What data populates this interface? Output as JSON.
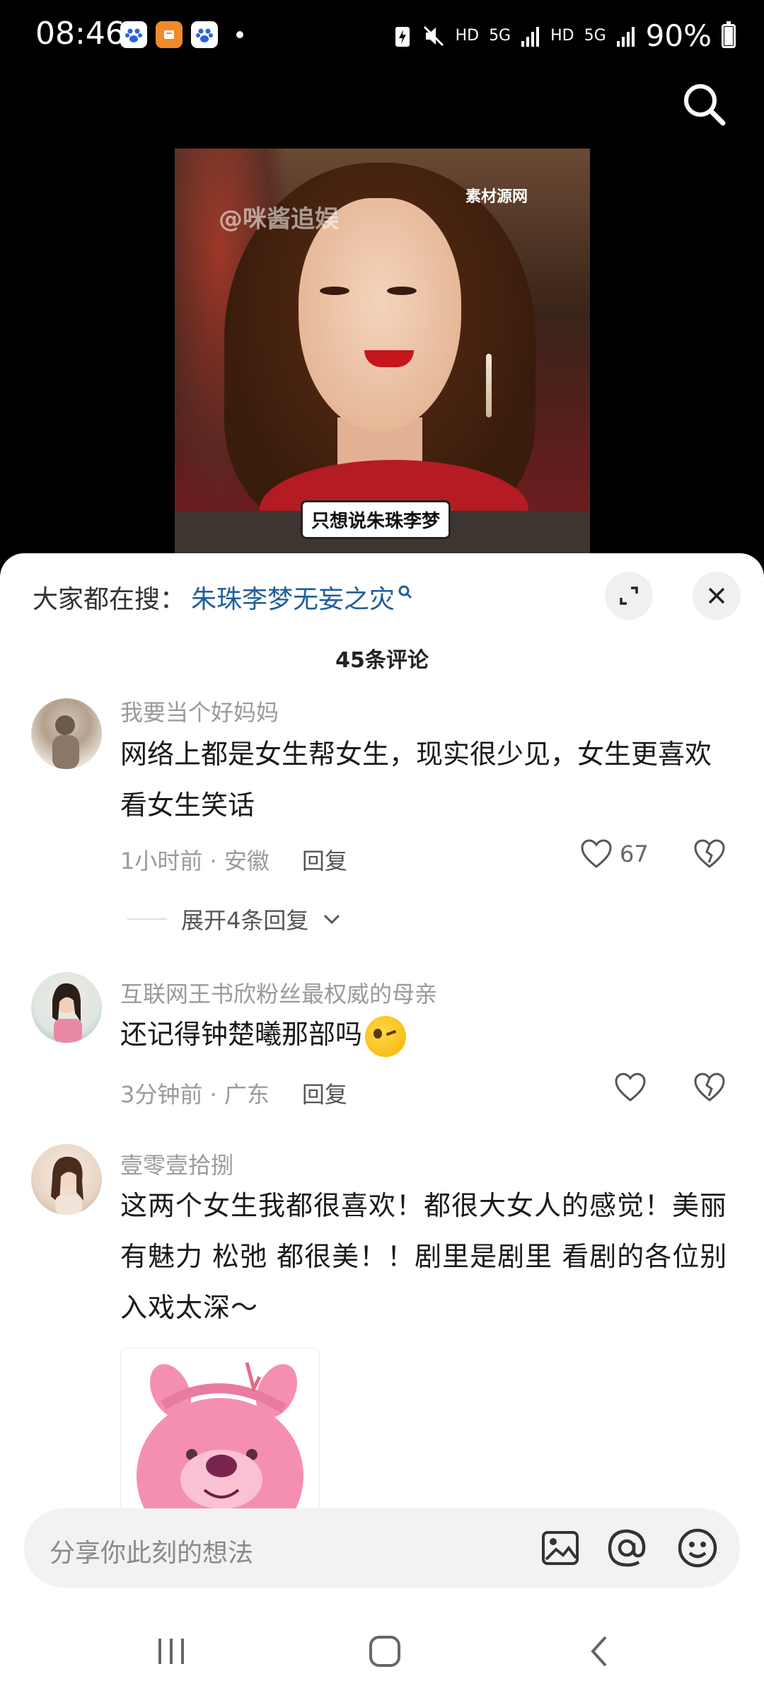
{
  "status_bar": {
    "time": "08:46",
    "battery": "90%",
    "net1": "HD",
    "net2": "5G",
    "net3": "HD",
    "net4": "5G"
  },
  "video": {
    "watermark_left": "@咪酱追娱",
    "watermark_right": "素材源网",
    "subtitle": "只想说朱珠李梦"
  },
  "sheet": {
    "hot_search_label": "大家都在搜：",
    "hot_search_keyword": "朱珠李梦无妄之灾",
    "comment_count": "45条评论"
  },
  "comments": [
    {
      "username": "我要当个好妈妈",
      "text": "网络上都是女生帮女生，现实很少见，女生更喜欢看女生笑话",
      "time_location": "1小时前 · 安徽",
      "reply": "回复",
      "likes": "67",
      "expand": "展开4条回复"
    },
    {
      "username": "互联网王书欣粉丝最权威的母亲",
      "text": "还记得钟楚曦那部吗",
      "time_location": "3分钟前 · 广东",
      "reply": "回复",
      "likes": ""
    },
    {
      "username": "壹零壹拾捌",
      "text": "这两个女生我都很喜欢！都很大女人的感觉！美丽有魅力 松弛 都很美！！剧里是剧里 看剧的各位别入戏太深～"
    }
  ],
  "input": {
    "placeholder": "分享你此刻的想法"
  },
  "colors": {
    "keyword": "#1f5e9a",
    "meta": "#9a9a9a",
    "dress": "#b41b22"
  },
  "icons": [
    "search-icon",
    "expand-icon",
    "close-icon",
    "heart-icon",
    "broken-heart-icon",
    "chevron-down-icon",
    "image-icon",
    "at-icon",
    "emoji-icon",
    "recent-apps-icon",
    "home-icon",
    "back-icon"
  ]
}
